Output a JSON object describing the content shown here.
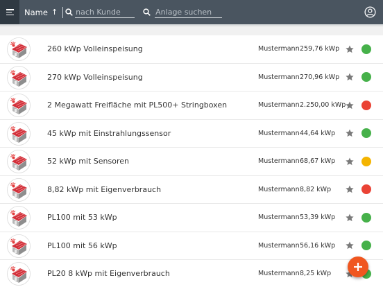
{
  "header": {
    "sort_label": "Name",
    "sort_direction_glyph": "↑",
    "customer_search_placeholder": "nach Kunde",
    "plant_search_placeholder": "Anlage suchen",
    "bg_color": "#4a5560",
    "icons": [
      "menu-icon",
      "search-icon",
      "search-icon",
      "account-icon"
    ]
  },
  "plants": [
    {
      "name": "260 kWp Volleinspeisung",
      "customer": "Mustermann",
      "power": "259,76 kWp",
      "status": "green"
    },
    {
      "name": "270 kWp Volleinspeisung",
      "customer": "Mustermann",
      "power": "270,96 kWp",
      "status": "green"
    },
    {
      "name": "2 Megawatt Freifläche mit PL500+ Stringboxen",
      "customer": "Mustermann",
      "power": "2.250,00 kWp",
      "status": "red"
    },
    {
      "name": "45 kWp mit Einstrahlungssensor",
      "customer": "Mustermann",
      "power": "44,64 kWp",
      "status": "green"
    },
    {
      "name": "52 kWp mit Sensoren",
      "customer": "Mustermann",
      "power": "68,67 kWp",
      "status": "yellow"
    },
    {
      "name": "8,82 kWp mit Eigenverbrauch",
      "customer": "Mustermann",
      "power": "8,82 kWp",
      "status": "red"
    },
    {
      "name": "PL100 mit 53 kWp",
      "customer": "Mustermann",
      "power": "53,39 kWp",
      "status": "green"
    },
    {
      "name": "PL100 mit 56 kWp",
      "customer": "Mustermann",
      "power": "56,16 kWp",
      "status": "green"
    },
    {
      "name": "PL20 8 kWp mit Eigenverbrauch",
      "customer": "Mustermann",
      "power": "8,25 kWp",
      "status": "green"
    }
  ],
  "status_colors": {
    "green": "#46b14a",
    "red": "#ea4335",
    "yellow": "#f4b400"
  },
  "fab": {
    "icon": "plus-icon",
    "color": "#f0561f"
  }
}
